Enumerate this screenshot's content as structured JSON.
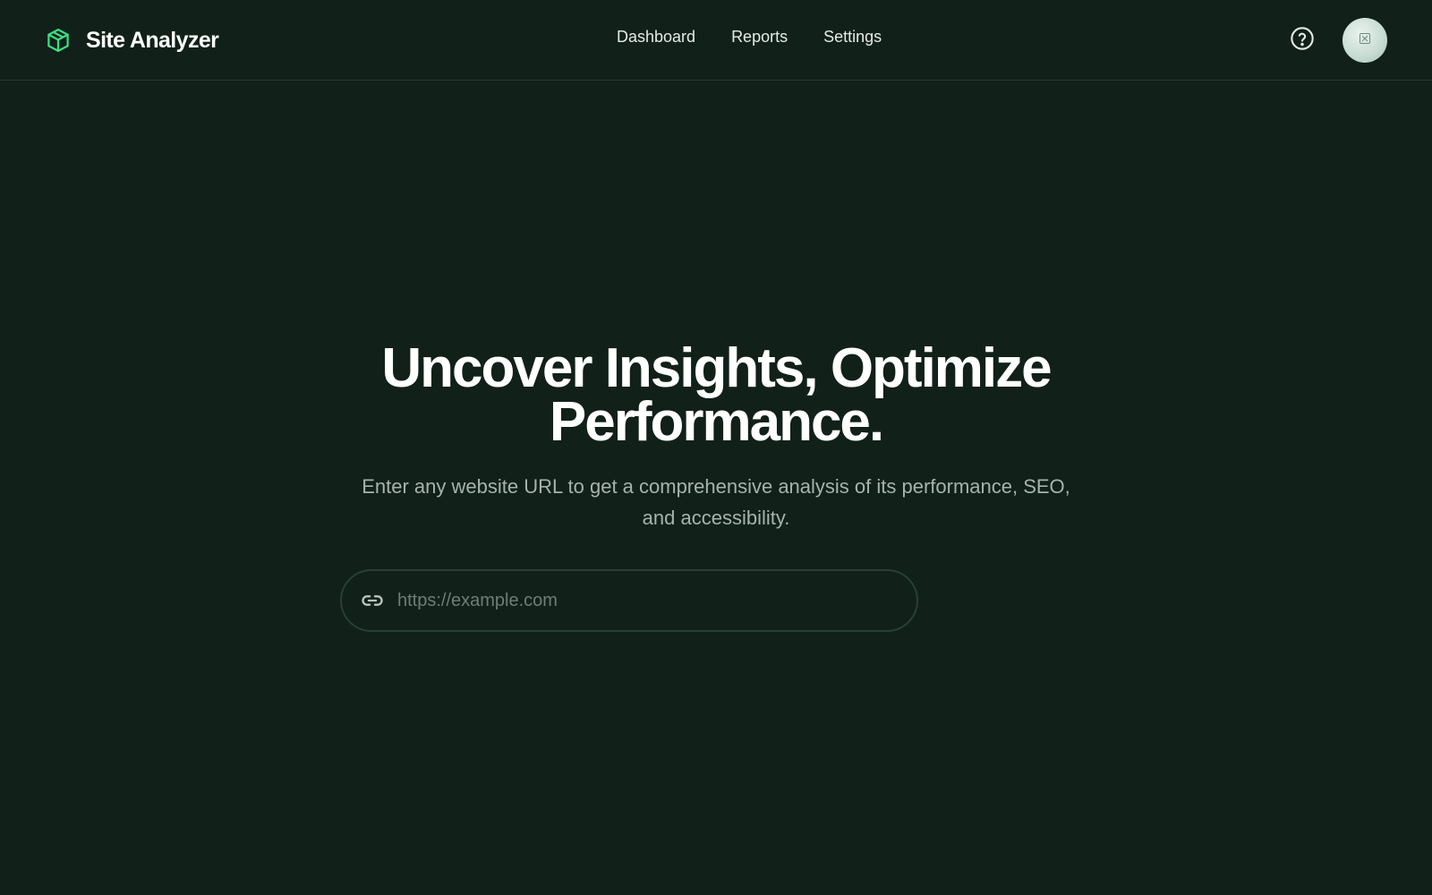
{
  "app": {
    "name": "Site Analyzer",
    "brand_icon": "cube-icon",
    "accent_color": "#3ddc84",
    "background_color": "#112019"
  },
  "nav": {
    "items": [
      {
        "label": "Dashboard"
      },
      {
        "label": "Reports"
      },
      {
        "label": "Settings"
      }
    ]
  },
  "header_actions": {
    "help_icon": "help-circle-icon",
    "avatar_icon": "user-avatar-icon"
  },
  "hero": {
    "title_line1": "Uncover Insights, Optimize",
    "title_line2": "Performance.",
    "subtitle": "Enter any website URL to get a comprehensive analysis of its performance, SEO, and accessibility."
  },
  "search": {
    "icon": "link-icon",
    "placeholder": "https://example.com",
    "value": ""
  }
}
